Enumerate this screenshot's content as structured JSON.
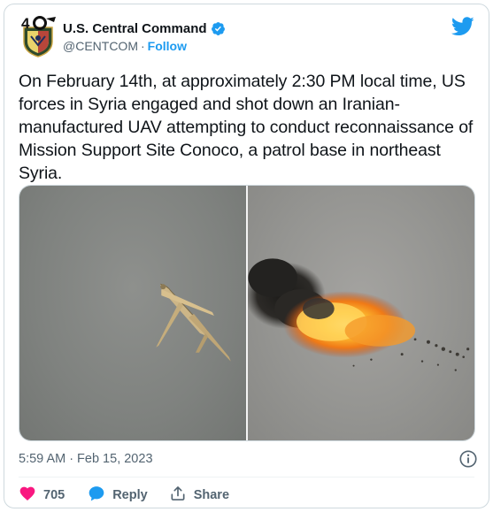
{
  "author": {
    "display_name": "U.S. Central Command",
    "handle": "@CENTCOM",
    "separator": "·",
    "follow_label": "Follow",
    "verified": true,
    "avatar_icon": "centcom-40th-anniversary-logo"
  },
  "tweet": {
    "text": "On February 14th, at approximately 2:30 PM local time, US forces in Syria engaged and shot down an Iranian-manufactured UAV attempting to conduct reconnaissance of Mission Support Site Conoco, a patrol base in northeast Syria.",
    "media": [
      {
        "icon": "uav-in-flight-photo"
      },
      {
        "icon": "uav-explosion-photo"
      }
    ]
  },
  "meta": {
    "time": "5:59 AM",
    "separator": "·",
    "date": "Feb 15, 2023"
  },
  "actions": {
    "likes": "705",
    "reply_label": "Reply",
    "share_label": "Share"
  },
  "icons": {
    "brand": "twitter-bird-icon",
    "verified": "verified-badge-icon",
    "info": "info-icon",
    "like": "heart-icon",
    "reply": "reply-bubble-icon",
    "share": "share-icon"
  },
  "colors": {
    "twitter_blue": "#1d9bf0",
    "like_pink": "#f91880",
    "text_primary": "#0f1419",
    "text_secondary": "#536471",
    "border": "#cfd9de"
  }
}
